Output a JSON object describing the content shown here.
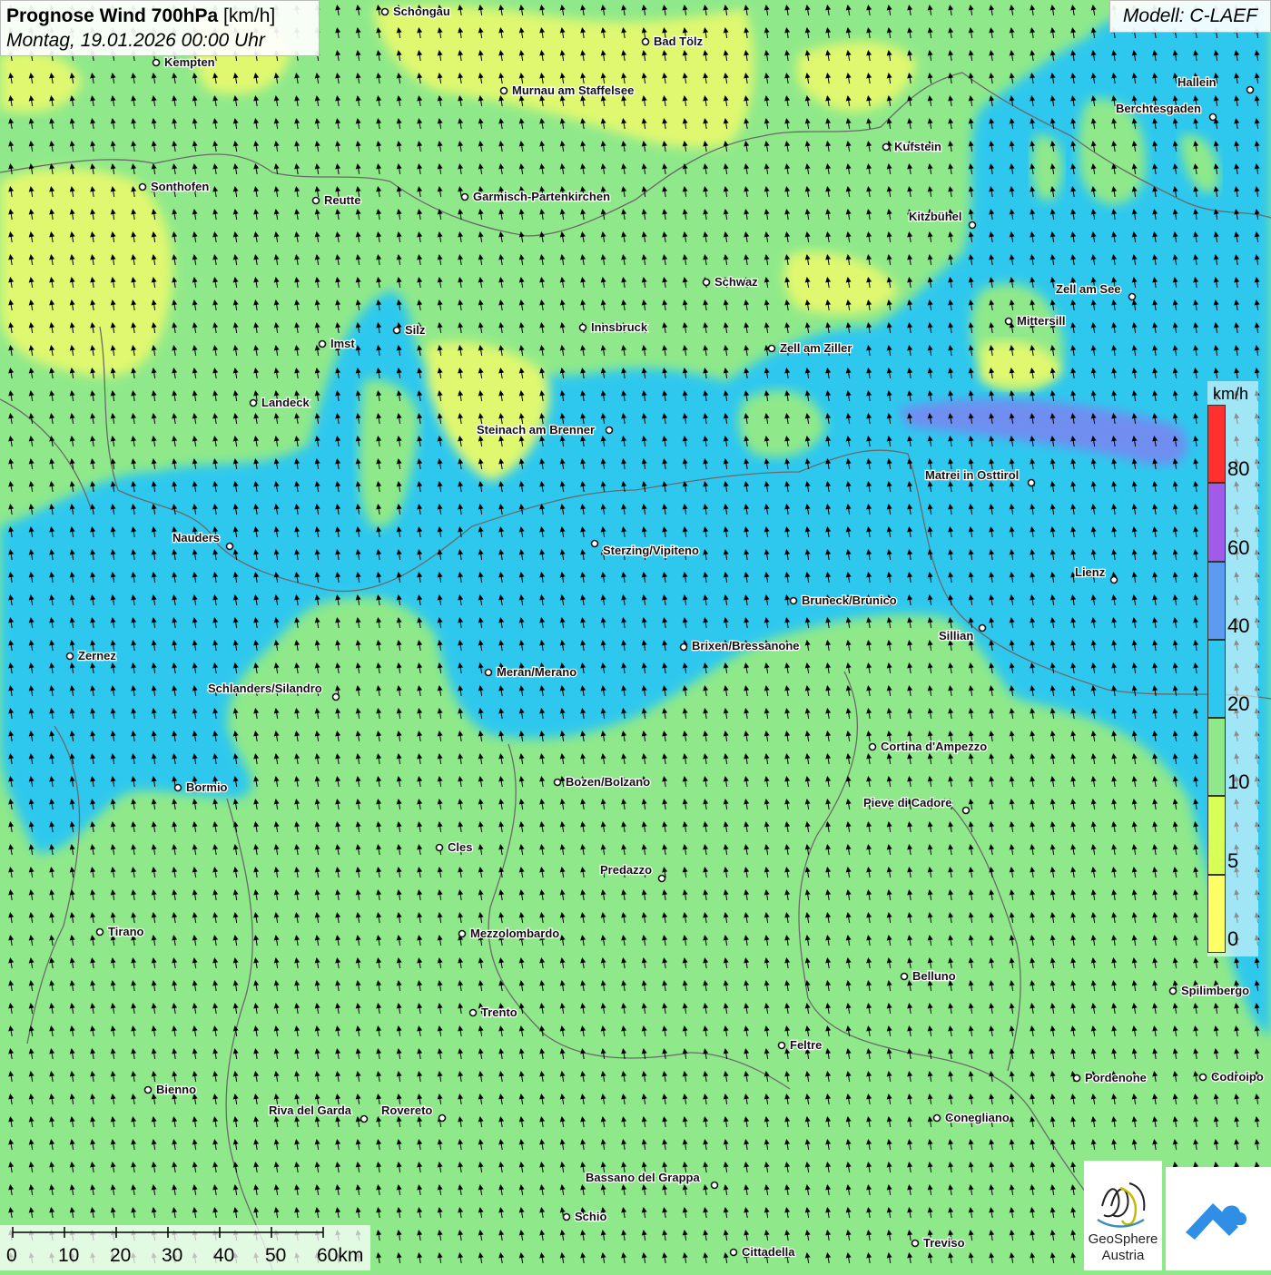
{
  "title": {
    "main": "Prognose Wind 700hPa",
    "unit": "[km/h]",
    "date": "Montag, 19.01.2026 00:00 Uhr"
  },
  "model": "Modell: C-LAEF",
  "legend": {
    "unit": "km/h",
    "classes": [
      {
        "label": "0",
        "color": "#ffff66"
      },
      {
        "label": "5",
        "color": "#d8ff55"
      },
      {
        "label": "10",
        "color": "#8fe98a"
      },
      {
        "label": "20",
        "color": "#2ec8ee"
      },
      {
        "label": "40",
        "color": "#5b9bf0"
      },
      {
        "label": "60",
        "color": "#a05ce8"
      },
      {
        "label": "80",
        "color": "#ff3030"
      }
    ]
  },
  "scalebar": {
    "labels": [
      "0",
      "10",
      "20",
      "30",
      "40",
      "50",
      "60km"
    ]
  },
  "logo": {
    "line1": "GeoSphere",
    "line2": "Austria"
  },
  "colors": {
    "background": "#8fe98a",
    "blue_zone": "#2ec8ee",
    "yellow_zone": "#e0f870",
    "arrow": "#000000",
    "border": "#666666",
    "logo_blue": "#2f8ee6"
  },
  "cities": [
    "Schongau",
    "Bad Tölz",
    "Kempten",
    "Murnau am Staffelsee",
    "Hallein",
    "Berchtesgaden",
    "Kufstein",
    "Sonthofen",
    "Reutte",
    "Garmisch-Partenkirchen",
    "Kitzbühel",
    "Schwaz",
    "Zell am See",
    "Mittersill",
    "Imst",
    "Silz",
    "Innsbruck",
    "Zell am Ziller",
    "Landeck",
    "Steinach am Brenner",
    "Matrei in Osttirol",
    "Nauders",
    "Sterzing/Vipiteno",
    "Lienz",
    "Bruneck/Brunico",
    "Sillian",
    "Zernez",
    "Brixen/Bressanone",
    "Meran/Merano",
    "Schlanders/Silandro",
    "Cortina d'Ampezzo",
    "Bormio",
    "Bozen/Bolzano",
    "Pieve di Cadore",
    "Cles",
    "Predazzo",
    "Tirano",
    "Mezzolombardo",
    "Belluno",
    "Spilimbergo",
    "Trento",
    "Feltre",
    "Pordenone",
    "Codroipo",
    "Bienno",
    "Riva del Garda",
    "Rovereto",
    "Conegliano",
    "Bassano del Grappa",
    "Schio",
    "Treviso",
    "Cittadella"
  ]
}
